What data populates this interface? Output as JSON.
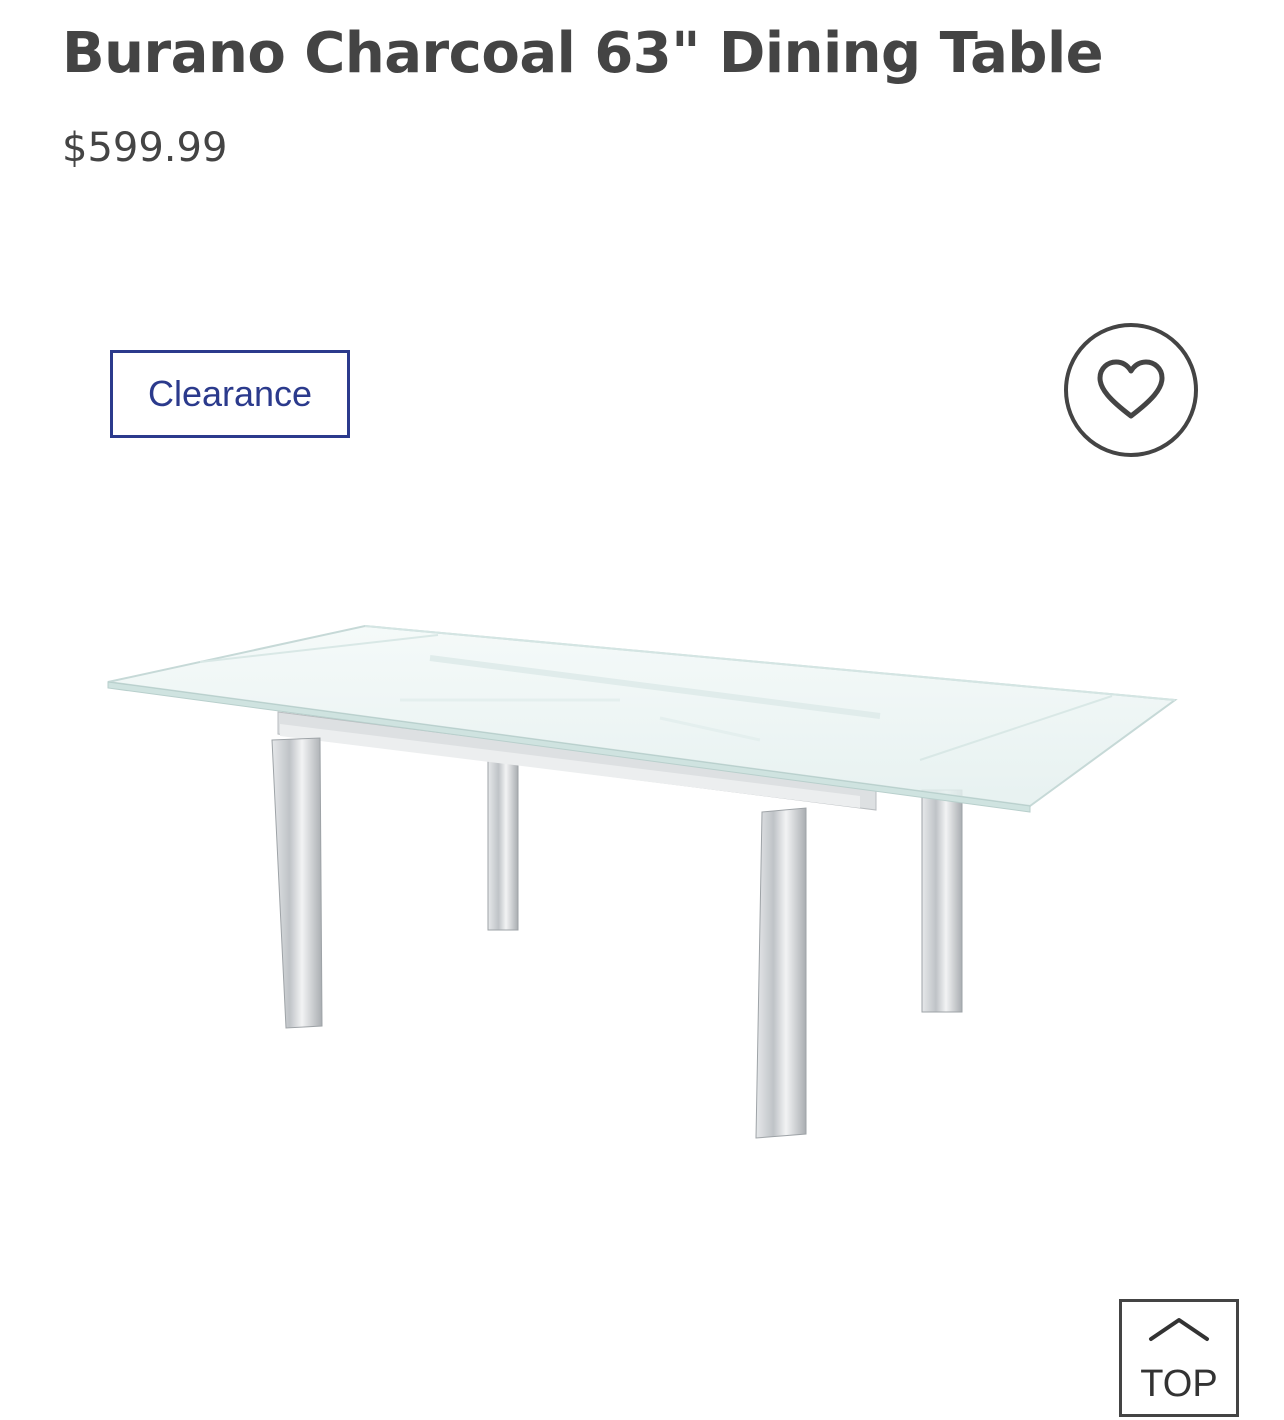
{
  "product": {
    "title": "Burano Charcoal 63\" Dining Table",
    "price": "$599.99",
    "badge": "Clearance",
    "image_icon": "glass-dining-table-image"
  },
  "wishlist": {
    "icon": "heart-icon"
  },
  "scroll_top": {
    "label": "TOP",
    "icon": "chevron-up-icon"
  },
  "colors": {
    "text": "#444444",
    "badge": "#2b3a8c",
    "background": "#ffffff"
  }
}
